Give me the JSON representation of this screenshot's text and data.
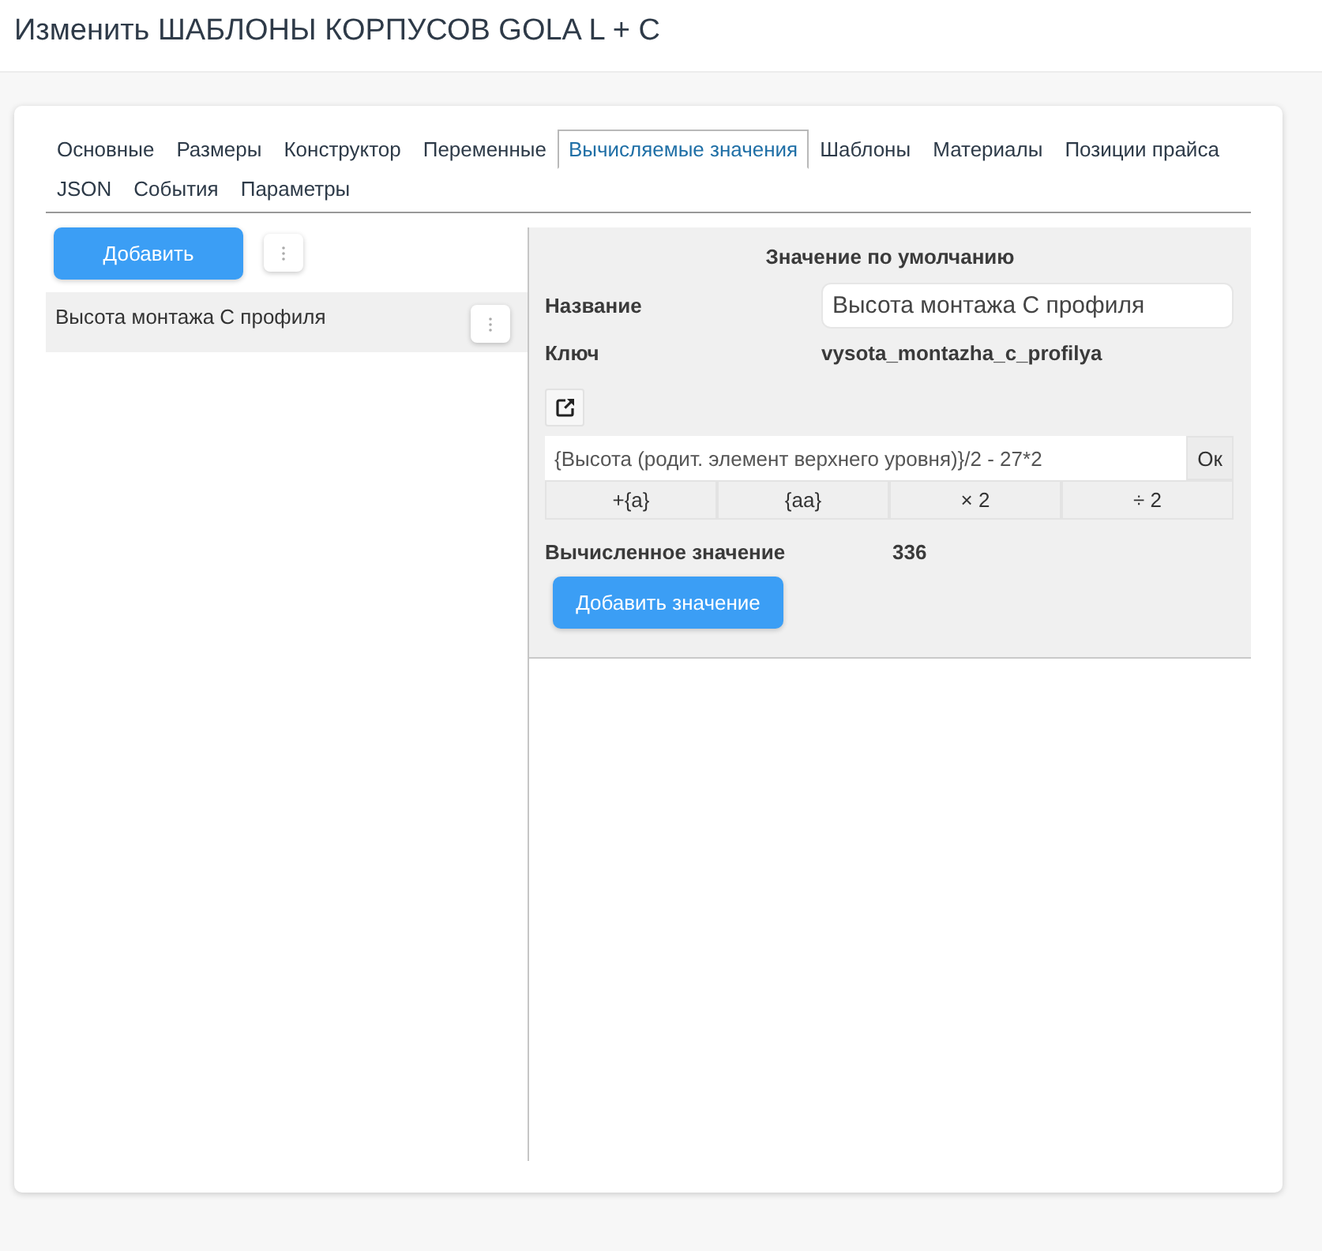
{
  "page": {
    "title": "Изменить ШАБЛОНЫ КОРПУСОВ GOLA L + C"
  },
  "tabs": [
    {
      "label": "Основные",
      "selected": false
    },
    {
      "label": "Размеры",
      "selected": false
    },
    {
      "label": "Конструктор",
      "selected": false
    },
    {
      "label": "Переменные",
      "selected": false
    },
    {
      "label": "Вычисляемые значения",
      "selected": true
    },
    {
      "label": "Шаблоны",
      "selected": false
    },
    {
      "label": "Материалы",
      "selected": false
    },
    {
      "label": "Позиции прайса",
      "selected": false
    },
    {
      "label": "JSON",
      "selected": false
    },
    {
      "label": "События",
      "selected": false
    },
    {
      "label": "Параметры",
      "selected": false
    }
  ],
  "list": {
    "add_button": "Добавить",
    "items": [
      {
        "label": "Высота монтажа С профиля",
        "selected": true
      }
    ]
  },
  "editor": {
    "heading": "Значение по умолчанию",
    "name_label": "Название",
    "name_value": "Высота монтажа С профиля",
    "key_label": "Ключ",
    "key_value": "vysota_montazha_c_profilya",
    "formula": "{Высота (родит. элемент верхнего уровня)}/2 - 27*2",
    "ok_button": "Ок",
    "operators": [
      "+{a}",
      "{aa}",
      "× 2",
      "÷ 2"
    ],
    "computed_label": "Вычисленное значение",
    "computed_value": "336",
    "add_value_button": "Добавить значение"
  }
}
